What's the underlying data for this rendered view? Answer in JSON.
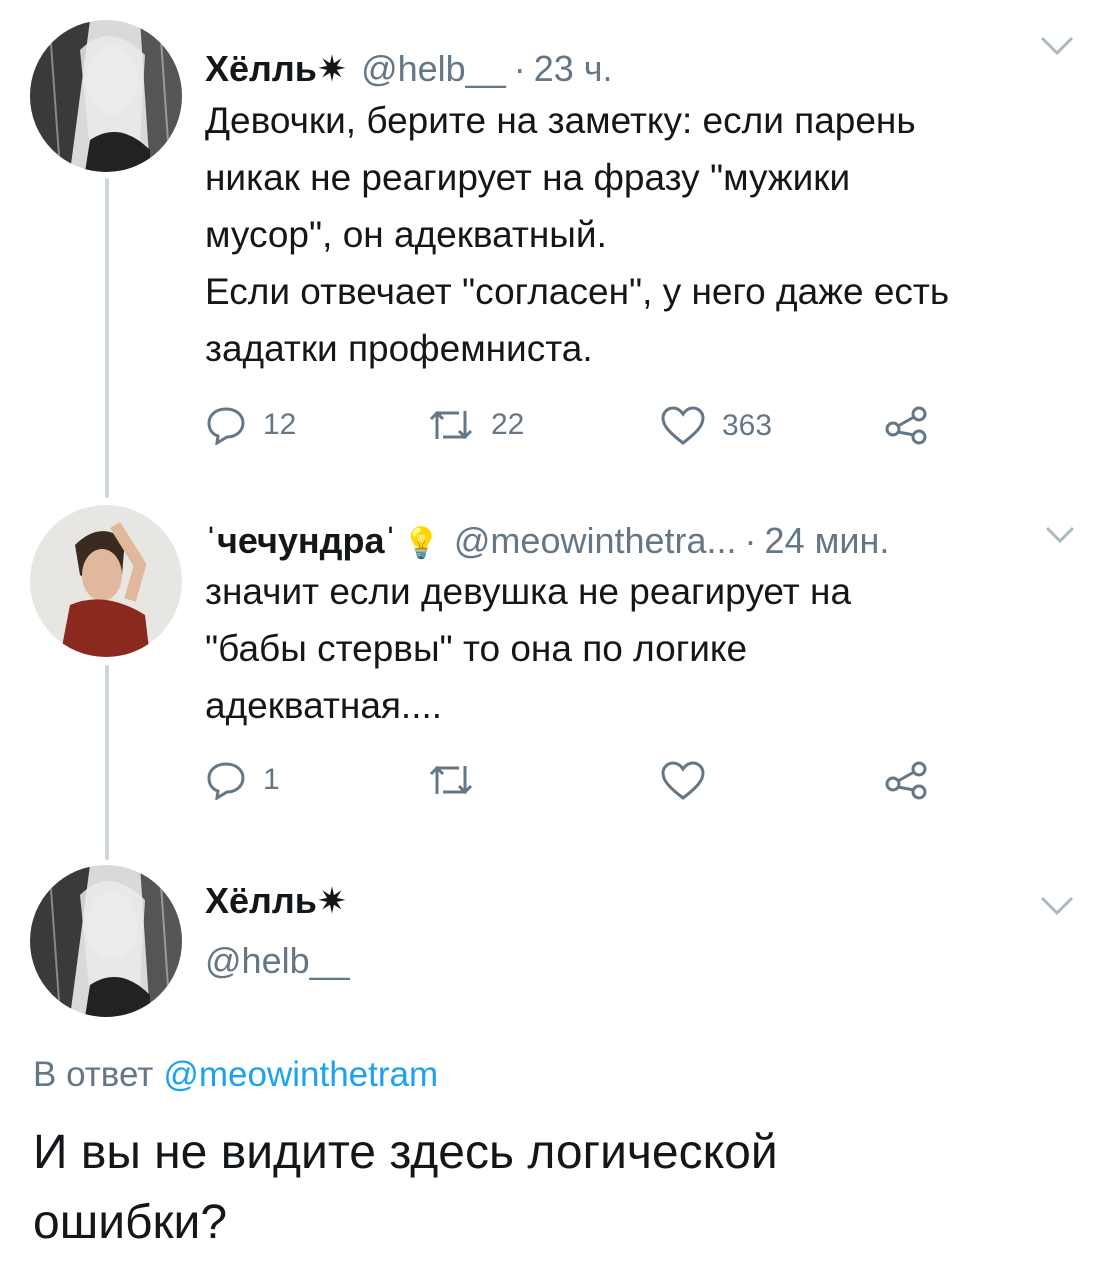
{
  "tweets": [
    {
      "author": {
        "name": "Хёлль✷",
        "handle": "@helb__"
      },
      "time": "23 ч.",
      "text": "Девочки, берите на заметку: если парень\nникак не реагирует на фразу \"мужики\nмусор\", он адекватный.\nЕсли отвечает \"согласен\", у него даже есть\nзадатки профемниста.",
      "stats": {
        "replies": "12",
        "retweets": "22",
        "likes": "363"
      }
    },
    {
      "author": {
        "name": "ˈчечундраˈ",
        "handle": "@meowinthetra...",
        "badge": "💡"
      },
      "time": "24 мин.",
      "text": "значит если девушка не реагирует на\n\"бабы стервы\" то она по логике\nадекватная....",
      "stats": {
        "replies": "1",
        "retweets": "",
        "likes": ""
      }
    }
  ],
  "main_tweet": {
    "author": {
      "name": "Хёлль✷",
      "handle": "@helb__"
    },
    "reply_prefix": "В ответ",
    "reply_mention": "@meowinthetram",
    "text": "И вы не видите здесь логической\nошибки?"
  },
  "icons": {
    "reply": "reply-icon",
    "retweet": "retweet-icon",
    "like": "heart-icon",
    "share": "share-icon",
    "menu": "chevron-down-icon"
  },
  "colors": {
    "text": "#14171a",
    "secondary": "#657786",
    "link": "#1da1f2",
    "thread_line": "#ccd6dd"
  }
}
